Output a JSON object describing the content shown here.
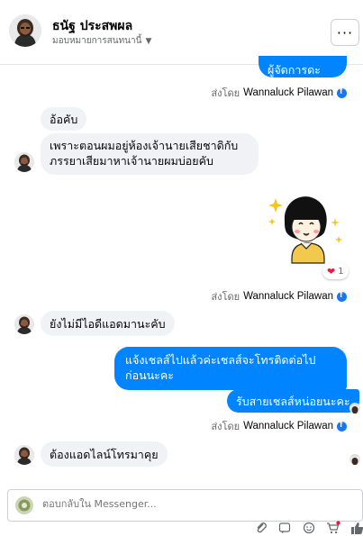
{
  "header": {
    "contact_name": "ธนัฐ ประสพผล",
    "subtitle": "มอบหมายการสนทนานี้",
    "more_label": "···"
  },
  "messages": [
    {
      "from": "page",
      "text": "ผู้จัดการดะลูกค้า"
    },
    {
      "from": "page-meta",
      "prefix": "ส่งโดย",
      "name": "Wannaluck Pilawan"
    },
    {
      "from": "customer",
      "text": "อ้อคับ"
    },
    {
      "from": "customer",
      "text": "เพราะตอนผมอยู่ห้องเจ้านายเสียชาดิกับภรรยาเสียมาหาเจ้านายผมบ่อยคับ"
    },
    {
      "from": "page",
      "sticker": "excited-girl-sticker",
      "reaction": {
        "emoji": "heart",
        "count": "1"
      }
    },
    {
      "from": "page-meta",
      "prefix": "ส่งโดย",
      "name": "Wannaluck Pilawan"
    },
    {
      "from": "customer",
      "text": "ยังไม่มีไอดีแอดมานะคับ"
    },
    {
      "from": "page",
      "text": "แจ้งเชลส์ไปแล้วค่ะเชลส์จะโทรติดต่อไปก่อนนะคะ"
    },
    {
      "from": "page",
      "text": "รับสายเชลส์หน่อยนะคะ"
    },
    {
      "from": "page-meta",
      "prefix": "ส่งโดย",
      "name": "Wannaluck Pilawan"
    },
    {
      "from": "customer",
      "text": "ต้องแอดไลน์โทรมาคุย"
    }
  ],
  "composer": {
    "placeholder": "ตอบกลับใน Messenger..."
  },
  "colors": {
    "accent": "#0084ff",
    "incoming_bubble": "#f0f2f5",
    "meta_text": "#65676b"
  },
  "icons": [
    "attach-icon",
    "gif-icon",
    "emoji-icon",
    "cart-icon",
    "like-icon"
  ]
}
